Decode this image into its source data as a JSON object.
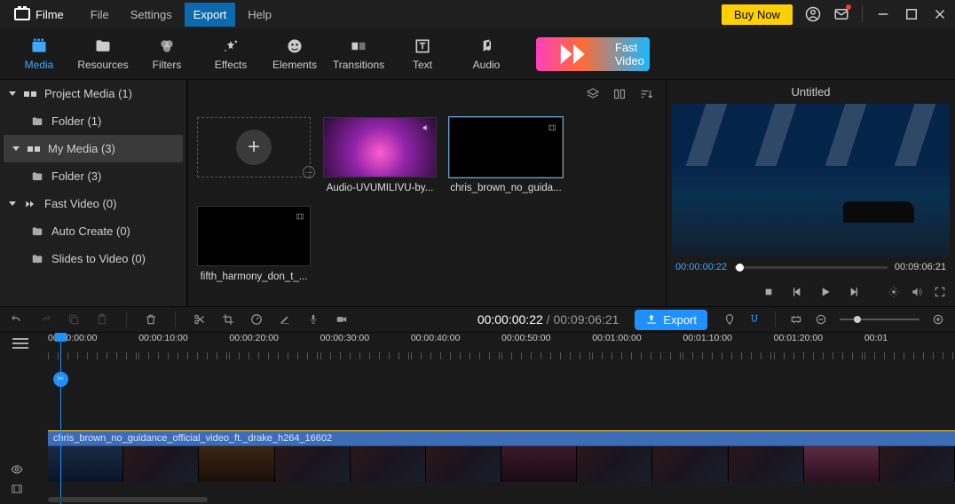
{
  "app": {
    "name": "Filme"
  },
  "menu": {
    "file": "File",
    "settings": "Settings",
    "export": "Export",
    "help": "Help"
  },
  "titlebar": {
    "buy": "Buy Now"
  },
  "tools": {
    "media": "Media",
    "resources": "Resources",
    "filters": "Filters",
    "effects": "Effects",
    "elements": "Elements",
    "transitions": "Transitions",
    "text": "Text",
    "audio": "Audio",
    "fast_video": "Fast Video"
  },
  "sidebar": {
    "project_media": "Project Media (1)",
    "project_folder": "Folder (1)",
    "my_media": "My Media (3)",
    "my_folder": "Folder (3)",
    "fast_video": "Fast Video (0)",
    "auto_create": "Auto Create (0)",
    "slides": "Slides to Video (0)"
  },
  "media": {
    "items": [
      {
        "label": ""
      },
      {
        "label": "Audio-UVUMILIVU-by..."
      },
      {
        "label": "chris_brown_no_guida..."
      },
      {
        "label": "fifth_harmony_don_t_..."
      }
    ]
  },
  "preview": {
    "title": "Untitled",
    "current": "00:00:00:22",
    "total": "00:09:06:21"
  },
  "tl": {
    "current": "00:00:00:22",
    "sep": " / ",
    "total": "00:09:06:21",
    "export": "Export",
    "ruler": [
      "00:00:00:00",
      "00:00:10:00",
      "00:00:20:00",
      "00:00:30:00",
      "00:00:40:00",
      "00:00:50:00",
      "00:01:00:00",
      "00:01:10:00",
      "00:01:20:00",
      "00:01"
    ],
    "clip": "chris_brown_no_guidance_official_video_ft._drake_h264_16602"
  }
}
